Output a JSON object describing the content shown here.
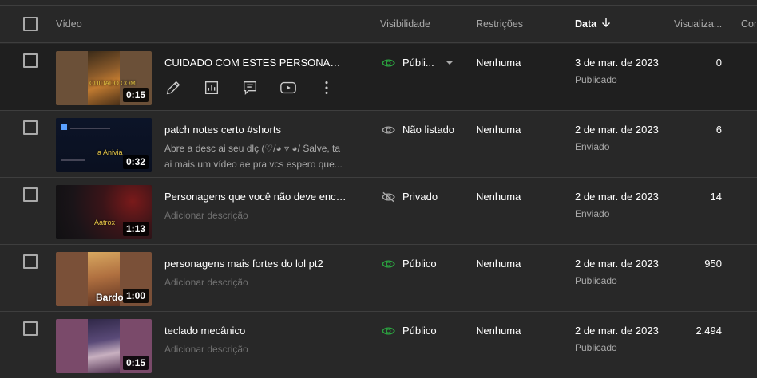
{
  "header": {
    "video": "Vídeo",
    "visibility": "Visibilidade",
    "restrictions": "Restrições",
    "date": "Data",
    "views": "Visualiza...",
    "comments": "Com"
  },
  "colors": {
    "public_eye": "#2ba640",
    "muted": "#aaaaaa",
    "background": "#282828",
    "hover_row": "#1f1f1f"
  },
  "rows": [
    {
      "title": "CUIDADO COM ESTES PERSONAGENS...",
      "description": "",
      "duration": "0:15",
      "thumb_caption": "",
      "visibility": "Públi...",
      "visibility_icon": "eye-icon",
      "restrictions": "Nenhuma",
      "date": "3 de mar. de 2023",
      "status": "Publicado",
      "views": "0"
    },
    {
      "title": "patch notes certo #shorts",
      "description": "Abre a desc ai seu dlç (♡/◕ ▿ ◕/ Salve, ta ai mais um vídeo ae pra vcs espero que...",
      "duration": "0:32",
      "thumb_caption": "a Anivia",
      "visibility": "Não listado",
      "visibility_icon": "eye-icon",
      "restrictions": "Nenhuma",
      "date": "2 de mar. de 2023",
      "status": "Enviado",
      "views": "6"
    },
    {
      "title": "Personagens que você não deve enco...",
      "description": "Adicionar descrição",
      "duration": "1:13",
      "thumb_caption": "Aatrox",
      "visibility": "Privado",
      "visibility_icon": "eye-off-icon",
      "restrictions": "Nenhuma",
      "date": "2 de mar. de 2023",
      "status": "Enviado",
      "views": "14"
    },
    {
      "title": "personagens mais fortes do lol pt2",
      "description": "Adicionar descrição",
      "duration": "1:00",
      "thumb_caption": "Bardo",
      "visibility": "Público",
      "visibility_icon": "eye-icon",
      "restrictions": "Nenhuma",
      "date": "2 de mar. de 2023",
      "status": "Publicado",
      "views": "950"
    },
    {
      "title": "teclado mecânico",
      "description": "Adicionar descrição",
      "duration": "0:15",
      "thumb_caption": "",
      "visibility": "Público",
      "visibility_icon": "eye-icon",
      "restrictions": "Nenhuma",
      "date": "2 de mar. de 2023",
      "status": "Publicado",
      "views": "2.494"
    }
  ]
}
